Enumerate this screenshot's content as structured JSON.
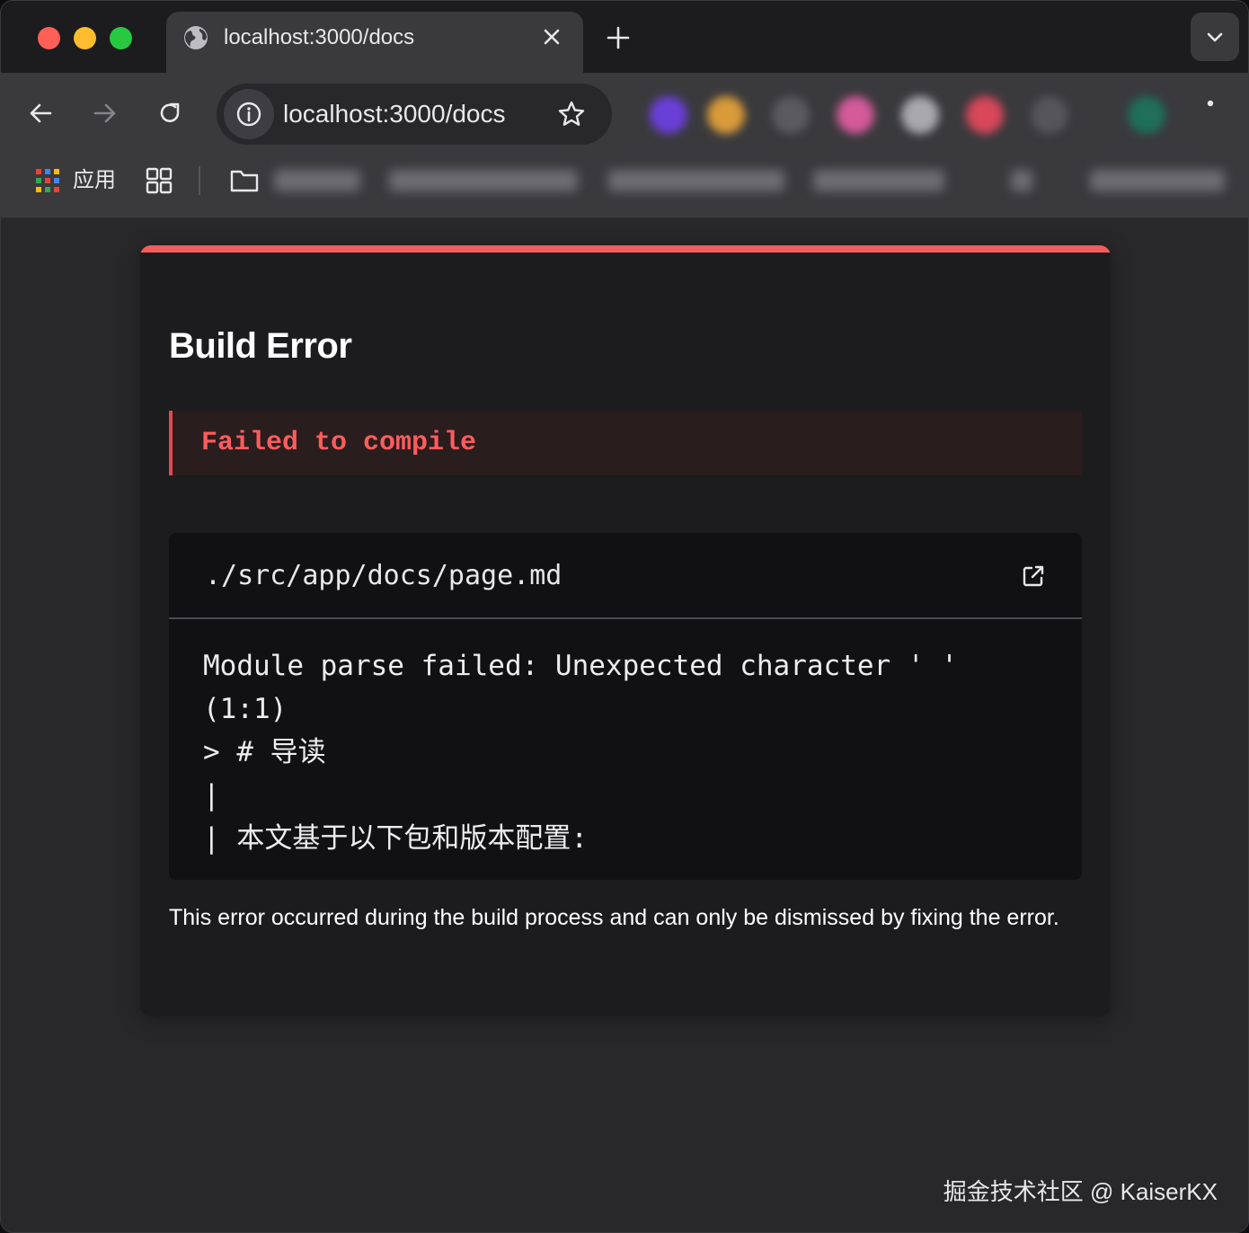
{
  "browser": {
    "tab": {
      "title": "localhost:3000/docs"
    },
    "address_bar": {
      "url": "localhost:3000/docs"
    },
    "bookmarks": {
      "apps_label": "应用"
    },
    "icons": {
      "tab_site": "globe-icon",
      "tab_close": "close-icon",
      "new_tab": "plus-icon",
      "tab_search": "chevron-down-icon",
      "back": "arrow-left-icon",
      "forward": "arrow-right-icon",
      "reload": "reload-icon",
      "site_info": "info-icon",
      "bookmark_star": "star-icon",
      "apps": "apps-grid-icon",
      "tab_groups": "tab-groups-icon",
      "folder": "folder-icon",
      "menu": "kebab-menu-icon"
    },
    "colors": {
      "traffic_close": "#ff5f57",
      "traffic_minimize": "#febc2e",
      "traffic_maximize": "#28c840"
    }
  },
  "error_overlay": {
    "title": "Build Error",
    "status": "Failed to compile",
    "file_path": "./src/app/docs/page.md",
    "code_lines": [
      "Module parse failed: Unexpected character ' '",
      "(1:1)",
      "> # 导读",
      "|",
      "| 本文基于以下包和版本配置:"
    ],
    "footer": "This error occurred during the build process and can only be dismissed by fixing the error.",
    "colors": {
      "accent": "#f25c5c",
      "error_text": "#ff5c5c",
      "callout_bg": "#2a1d1e"
    }
  },
  "watermark": "掘金技术社区 @ KaiserKX"
}
